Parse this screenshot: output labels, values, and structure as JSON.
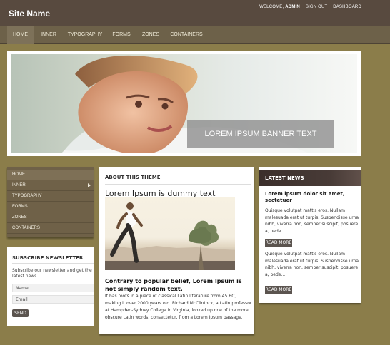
{
  "header": {
    "site_name": "Site Name",
    "welcome": "WELCOME,",
    "user": "ADMIN",
    "sign_out": "SIGN OUT",
    "dashboard": "DASHBOARD"
  },
  "nav": {
    "items": [
      {
        "label": "HOME"
      },
      {
        "label": "INNER"
      },
      {
        "label": "TYPOGRAPHY"
      },
      {
        "label": "FORMS"
      },
      {
        "label": "ZONES"
      },
      {
        "label": "CONTAINERS"
      }
    ],
    "search_icon": "search-icon"
  },
  "banner": {
    "text": "LOREM IPSUM BANNER TEXT"
  },
  "sidebar": {
    "items": [
      {
        "label": "HOME"
      },
      {
        "label": "INNER"
      },
      {
        "label": "TYPOGRAPHY"
      },
      {
        "label": "FORMS"
      },
      {
        "label": "ZONES"
      },
      {
        "label": "CONTAINERS"
      }
    ]
  },
  "newsletter": {
    "title": "SUBSCRIBE NEWSLETTER",
    "description": "Subscribe our newsletter and get the latest news.",
    "name_placeholder": "Name",
    "email_placeholder": "Email",
    "send": "SEND"
  },
  "main": {
    "heading": "ABOUT THIS THEME",
    "title": "Lorem Ipsum is dummy text",
    "subtitle": "Contrary to popular belief, Lorem Ipsum is not simply random text.",
    "body": "It has roots in a piece of classical Latin literature from 45 BC, making it over 2000 years old. Richard McClintock, a Latin professor at Hampden-Sydney College in Virginia, looked up one of the more obscure Latin words, consectetur, from a Lorem Ipsum passage."
  },
  "news": {
    "heading": "LATEST NEWS",
    "item_title": "Lorem ipsum dolor sit amet, sectetuer",
    "item_text": "Quisque volutpat mattis eros. Nullam malesuada erat ut turpis. Suspendisse urna nibh, viverra non, semper suscipit, posuere a, pede...",
    "read_more": "READ MORE",
    "item2_text": "Quisque volutpat mattis eros. Nullam malesuada erat ut turpis. Suspendisse urna nibh, viverra non, semper suscipit, posuere a, pede...",
    "read_more2": "READ MORE"
  },
  "colors": {
    "background": "#8b7d4a",
    "header": "#584a3f",
    "nav": "#6d6149",
    "sidebar": "#6f6148",
    "button": "#5b544f"
  }
}
